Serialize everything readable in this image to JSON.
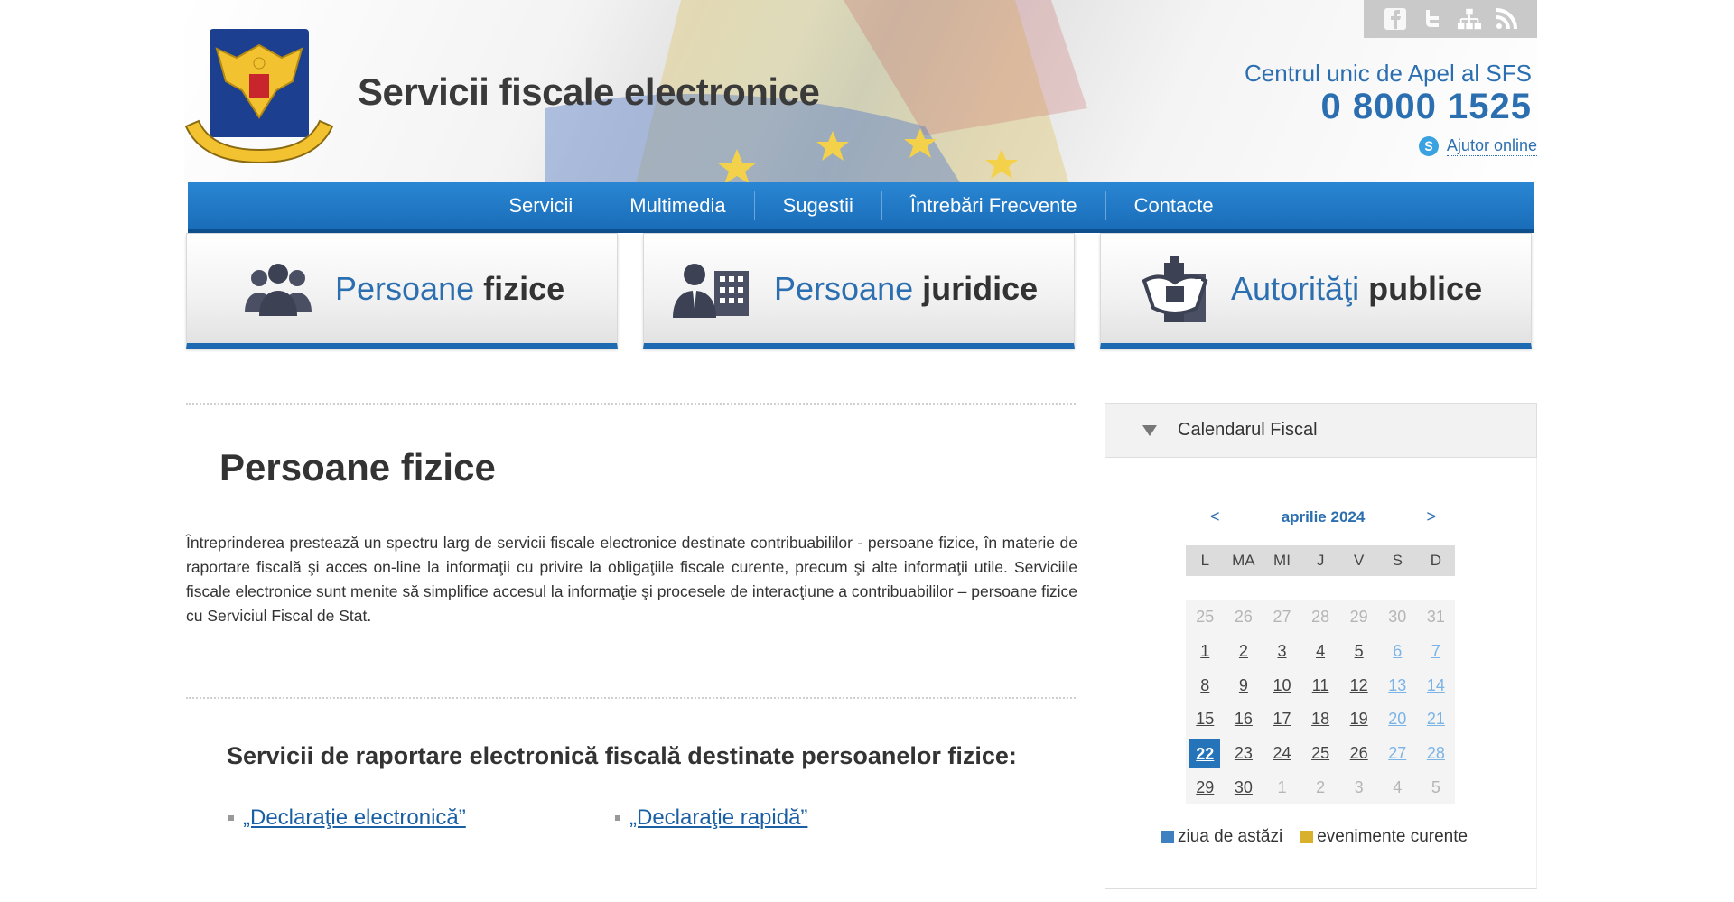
{
  "header": {
    "site_title": "Servicii fiscale electronice",
    "callcenter_label": "Centrul unic de Apel al SFS",
    "callcenter_number": "0 8000 1525",
    "help_online": "Ajutor online",
    "social_icons": [
      "facebook-icon",
      "twitter-icon",
      "sitemap-icon",
      "rss-icon"
    ]
  },
  "nav": {
    "items": [
      "Servicii",
      "Multimedia",
      "Sugestii",
      "Întrebări Frecvente",
      "Contacte"
    ]
  },
  "categories": [
    {
      "light": "Persoane ",
      "bold": "fizice",
      "icon": "people-icon"
    },
    {
      "light": "Persoane ",
      "bold": "juridice",
      "icon": "business-person-icon"
    },
    {
      "light": "Autorităţi ",
      "bold": "publice",
      "icon": "coat-of-arms-building-icon"
    }
  ],
  "content": {
    "heading": "Persoane fizice",
    "intro": "Întreprinderea prestează un spectru larg de servicii fiscale electronice destinate contribuabililor - persoane fizice, în materie de raportare fiscală şi acces on-line la informaţii cu privire la obligaţiile fiscale curente, precum şi alte informaţii utile. Serviciile fiscale electronice sunt menite să simplifice accesul la informaţie şi procesele de interacţiune a contribuabililor – persoane fizice cu Serviciul Fiscal de Stat.",
    "section_heading": "Servicii de raportare electronică fiscală destinate persoanelor fizice:",
    "links": [
      "„Declaraţie electronică”",
      "„Declaraţie rapidă”"
    ]
  },
  "calendar": {
    "title": "Calendarul Fiscal",
    "prev": "<",
    "next": ">",
    "month": "aprilie 2024",
    "weekdays": [
      "L",
      "MA",
      "MI",
      "J",
      "V",
      "S",
      "D"
    ],
    "weeks": [
      [
        "25",
        "26",
        "27",
        "28",
        "29",
        "30",
        "31"
      ],
      [
        "1",
        "2",
        "3",
        "4",
        "5",
        "6",
        "7"
      ],
      [
        "8",
        "9",
        "10",
        "11",
        "12",
        "13",
        "14"
      ],
      [
        "15",
        "16",
        "17",
        "18",
        "19",
        "20",
        "21"
      ],
      [
        "22",
        "23",
        "24",
        "25",
        "26",
        "27",
        "28"
      ],
      [
        "29",
        "30",
        "1",
        "2",
        "3",
        "4",
        "5"
      ]
    ],
    "today": "22",
    "legend": [
      {
        "label": "ziua de astăzi",
        "color": "#3f80c0"
      },
      {
        "label": "evenimente curente",
        "color": "#d9b02b"
      }
    ]
  },
  "colors": {
    "brand_blue": "#2c6fb1",
    "nav_blue": "#1f77c4"
  }
}
